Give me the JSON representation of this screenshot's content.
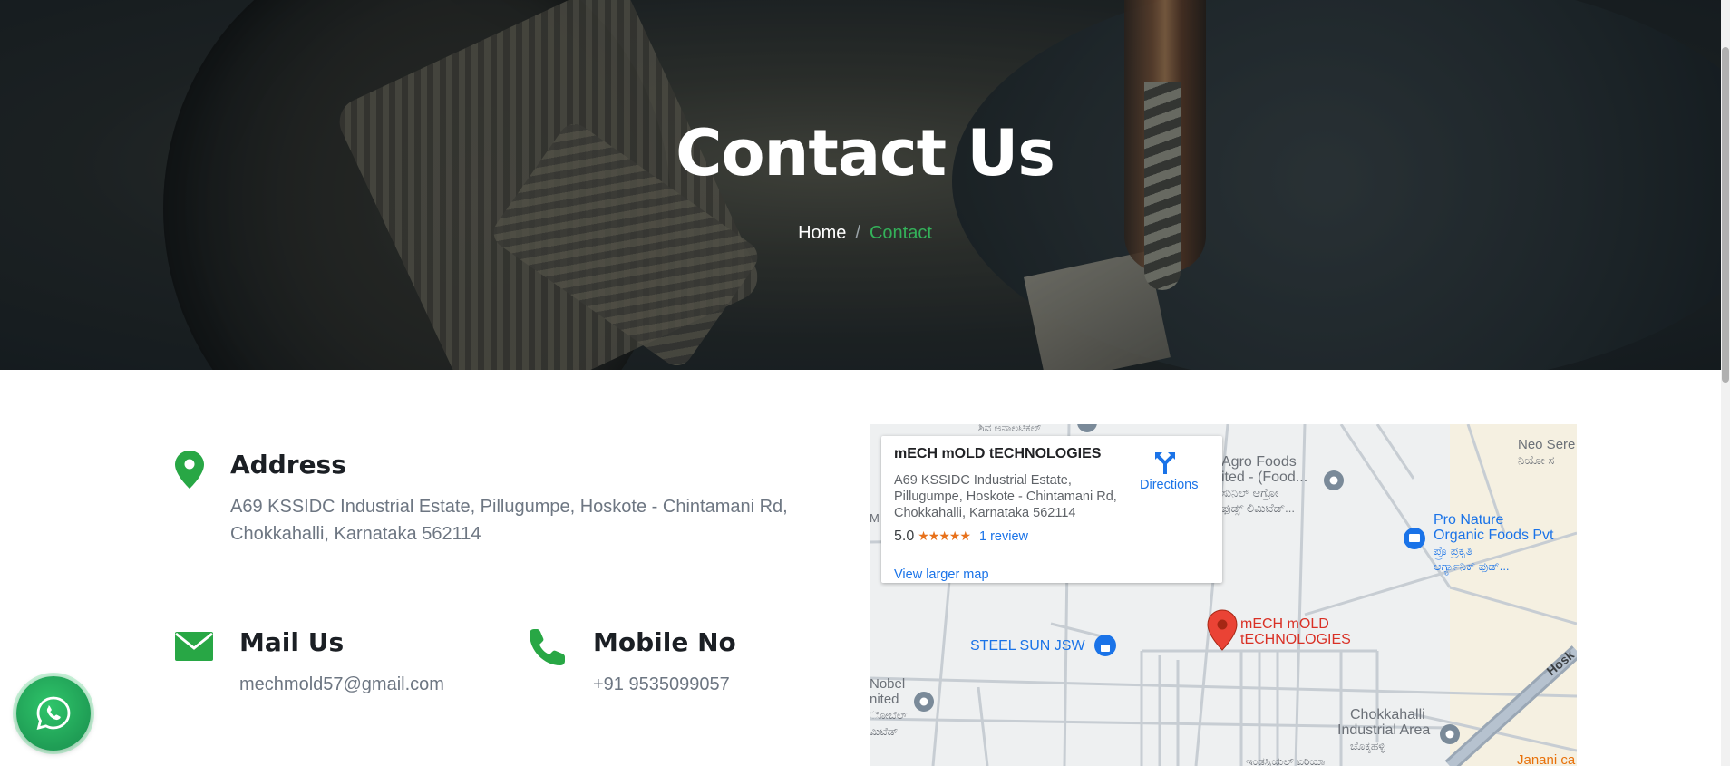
{
  "hero": {
    "title": "Contact Us",
    "breadcrumb": {
      "home": "Home",
      "separator": "/",
      "current": "Contact"
    }
  },
  "contact": {
    "address": {
      "title": "Address",
      "text": "A69 KSSIDC Industrial Estate, Pillugumpe, Hoskote - Chintamani Rd, Chokkahalli, Karnataka 562114",
      "icon": "map-pin-icon"
    },
    "mail": {
      "title": "Mail Us",
      "text": "mechmold57@gmail.com",
      "icon": "envelope-icon"
    },
    "mobile": {
      "title": "Mobile No",
      "text": "+91 9535099057",
      "icon": "phone-icon"
    }
  },
  "map": {
    "card": {
      "place_name": "mECH mOLD tECHNOLOGIES",
      "address": "A69 KSSIDC Industrial Estate, Pillugumpe, Hoskote - Chintamani Rd, Chokkahalli, Karnataka 562114",
      "rating": "5.0",
      "stars": "★★★★★",
      "reviews": "1 review",
      "view_larger": "View larger map",
      "directions": "Directions"
    },
    "labels": {
      "marker_line1": "mECH mOLD",
      "marker_line2": "tECHNOLOGIES",
      "steel_sun": "STEEL SUN JSW",
      "agro_line1": "Agro Foods",
      "agro_line2": "ited - (Food...",
      "agro_line3": "ಸುನಿಲ್ ಆಗ್ರೋ",
      "agro_line4": "ಫುಡ್ಸ್ ಲಿಮಿಟೆಡ್...",
      "pro_line1": "Pro Nature",
      "pro_line2": "Organic Foods Pvt",
      "pro_line3": "ಪ್ರೊ ಪ್ರಕೃತಿ",
      "pro_line4": "ಆರ್ಗ್ಯಾನಿಕ್ ಫುಡ್...",
      "neo_line1": "Neo Sere",
      "neo_line2": "ನಿಯೋ ಸ",
      "nobel_line1": "Nobel",
      "nobel_line2": "nited",
      "nobel_line3": "ೋಬೆಲ್",
      "nobel_line4": "ಮಿಟೆಡ್",
      "chokk_line1": "Chokkahalli",
      "chokk_line2": "Industrial Area",
      "chokk_line3": "ಚೊಕ್ಕಹಳ್ಳಿ",
      "top_kannada": "ಶಿವ ಅನಾಲಟಿಕಲ್",
      "bottom_kannada": "ಇಂಡಸ್ಟ್ರಿಯಲ್ ಏರಿಯಾ",
      "janani": "Janani ca",
      "hoskote": "Hosk",
      "left_edge": "M"
    }
  },
  "whatsapp": {
    "icon": "whatsapp-icon"
  },
  "colors": {
    "accent_green": "#34b25a",
    "icon_green": "#28a745",
    "link_blue": "#1a73e8",
    "marker_red": "#d93025"
  }
}
